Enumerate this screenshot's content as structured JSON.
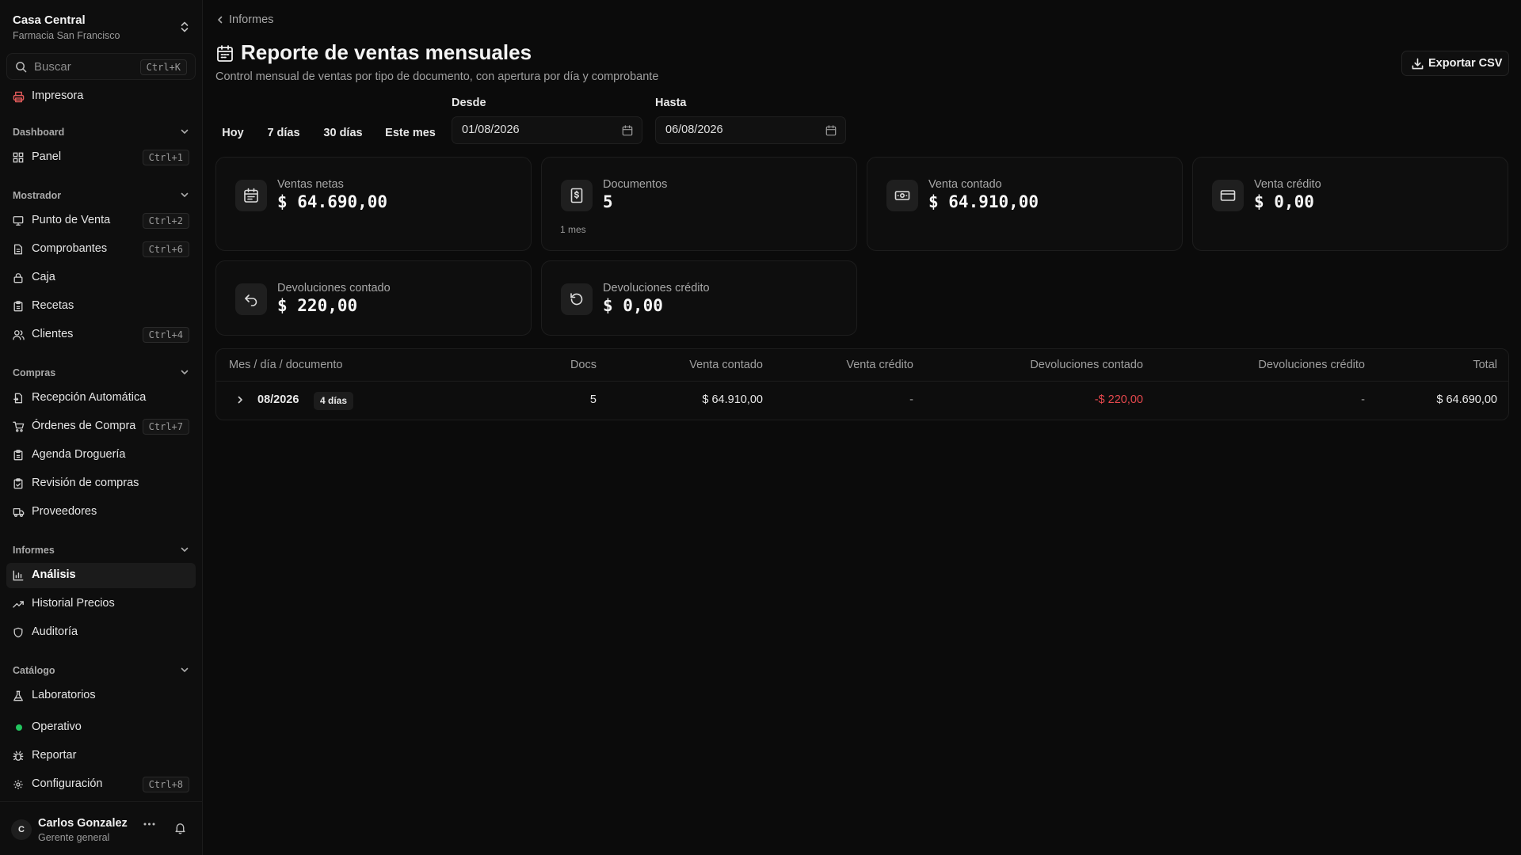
{
  "org": {
    "name": "Casa Central",
    "subtitle": "Farmacia San Francisco"
  },
  "search": {
    "placeholder": "Buscar",
    "shortcut": "Ctrl+K"
  },
  "sidebar": {
    "printer": "Impresora",
    "sections": {
      "dashboard": "Dashboard",
      "mostrador": "Mostrador",
      "compras": "Compras",
      "informes": "Informes",
      "catalogo": "Catálogo"
    },
    "items": {
      "panel": {
        "label": "Panel",
        "shortcut": "Ctrl+1"
      },
      "pos": {
        "label": "Punto de Venta",
        "shortcut": "Ctrl+2"
      },
      "comprobantes": {
        "label": "Comprobantes",
        "shortcut": "Ctrl+6"
      },
      "caja": {
        "label": "Caja"
      },
      "recetas": {
        "label": "Recetas"
      },
      "clientes": {
        "label": "Clientes",
        "shortcut": "Ctrl+4"
      },
      "recepcion": {
        "label": "Recepción Automática"
      },
      "ordenes": {
        "label": "Órdenes de Compra",
        "shortcut": "Ctrl+7"
      },
      "agenda": {
        "label": "Agenda Droguería"
      },
      "revision": {
        "label": "Revisión de compras"
      },
      "proveedores": {
        "label": "Proveedores"
      },
      "analisis": {
        "label": "Análisis"
      },
      "historial": {
        "label": "Historial Precios"
      },
      "auditoria": {
        "label": "Auditoría"
      },
      "laboratorios": {
        "label": "Laboratorios"
      }
    },
    "footer": {
      "operativo": "Operativo",
      "reportar": "Reportar",
      "configuracion": {
        "label": "Configuración",
        "shortcut": "Ctrl+8"
      }
    }
  },
  "user": {
    "initial": "C",
    "name": "Carlos Gonzalez",
    "role": "Gerente general"
  },
  "main": {
    "breadcrumb": "Informes",
    "title": "Reporte de ventas mensuales",
    "subtitle": "Control mensual de ventas por tipo de documento, con apertura por día y comprobante",
    "export": "Exportar CSV",
    "ranges": [
      "Hoy",
      "7 días",
      "30 días",
      "Este mes"
    ],
    "from": {
      "label": "Desde",
      "value": "01/08/2026"
    },
    "to": {
      "label": "Hasta",
      "value": "06/08/2026"
    }
  },
  "cards": {
    "ventas_netas": {
      "label": "Ventas netas",
      "value": "$ 64.690,00"
    },
    "documentos": {
      "label": "Documentos",
      "value": "5",
      "note": "1 mes"
    },
    "venta_contado": {
      "label": "Venta contado",
      "value": "$ 64.910,00"
    },
    "venta_credito": {
      "label": "Venta crédito",
      "value": "$ 0,00"
    },
    "dev_contado": {
      "label": "Devoluciones contado",
      "value": "$ 220,00"
    },
    "dev_credito": {
      "label": "Devoluciones crédito",
      "value": "$ 0,00"
    }
  },
  "table": {
    "headers": {
      "mes": "Mes / día / documento",
      "docs": "Docs",
      "contado": "Venta contado",
      "credito": "Venta crédito",
      "dev_contado": "Devoluciones contado",
      "dev_credito": "Devoluciones crédito",
      "total": "Total"
    },
    "rows": [
      {
        "period": "08/2026",
        "days": "4 días",
        "docs": "5",
        "contado": "$ 64.910,00",
        "credito": "-",
        "dev_contado": "-$ 220,00",
        "dev_credito": "-",
        "total": "$ 64.690,00"
      }
    ]
  },
  "colors": {
    "negative": "#e5484d",
    "status_ok": "#22c55e",
    "printer": "#e05a5a"
  }
}
